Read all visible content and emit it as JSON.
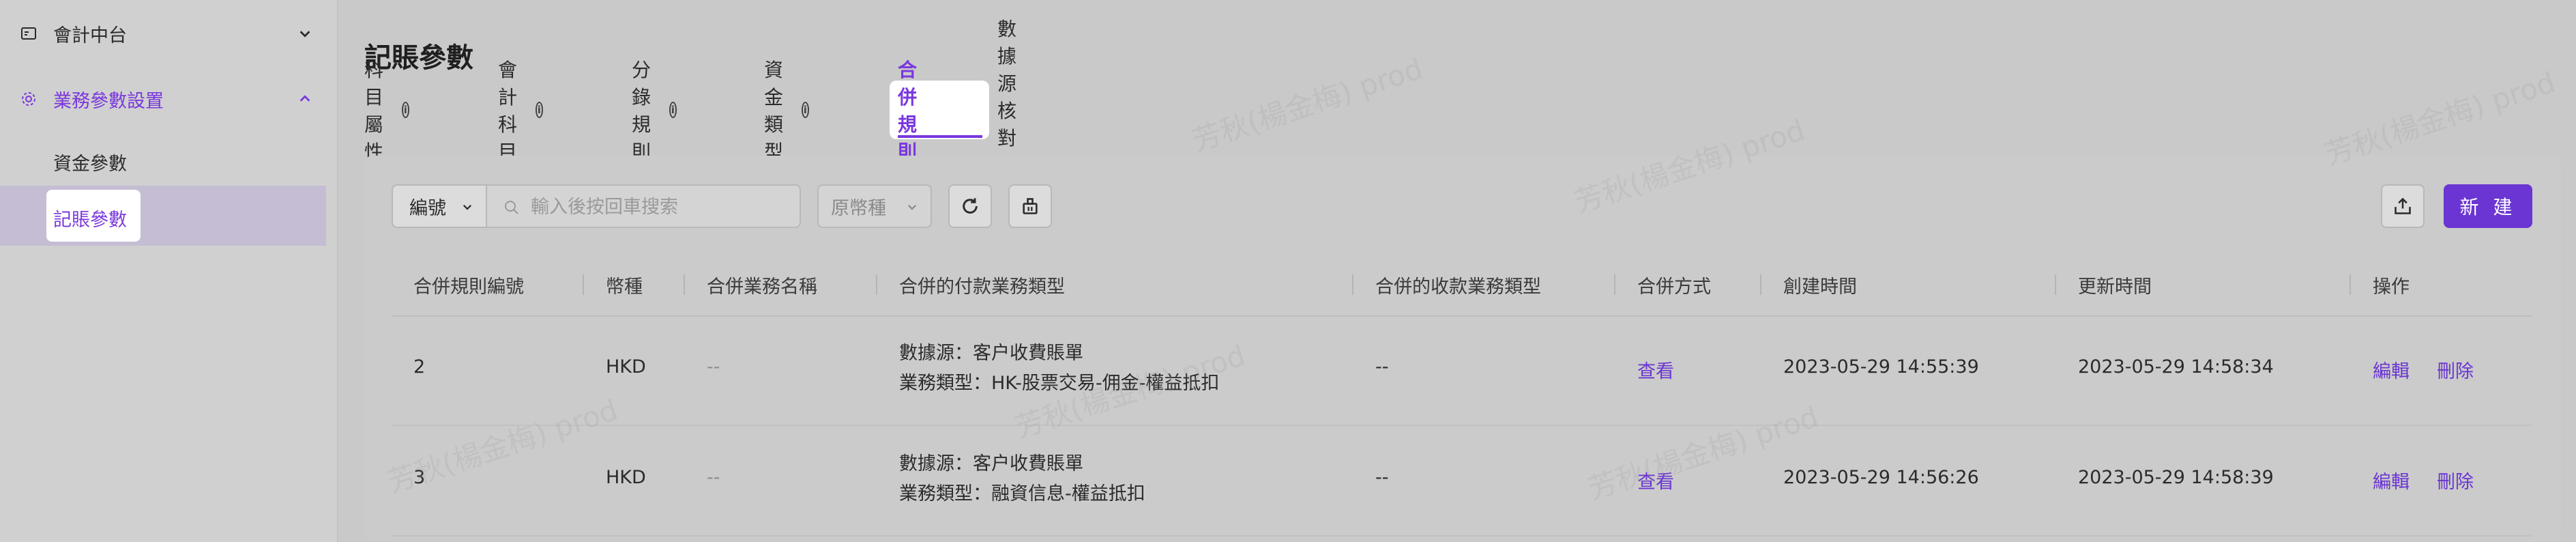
{
  "sidebar": {
    "group1": {
      "label": "會計中台",
      "icon": "ledger-icon"
    },
    "group2": {
      "label": "業務參數設置",
      "icon": "gear-icon"
    },
    "sub_items": [
      {
        "label": "資金參數"
      },
      {
        "label": "記賬參數"
      }
    ]
  },
  "page": {
    "title": "記賬參數"
  },
  "tabs": [
    {
      "label": "科目屬性"
    },
    {
      "label": "會計科目"
    },
    {
      "label": "分錄規則"
    },
    {
      "label": "資金類型"
    },
    {
      "label": "合併規則"
    },
    {
      "label": "數據源核對規則"
    }
  ],
  "toolbar": {
    "field_select": "編號",
    "search_placeholder": "輸入後按回車搜索",
    "currency_placeholder": "原幣種",
    "new_label": "新 建"
  },
  "table": {
    "headers": [
      "合併規則編號",
      "幣種",
      "合併業務名稱",
      "合併的付款業務類型",
      "合併的收款業務類型",
      "合併方式",
      "創建時間",
      "更新時間",
      "操作"
    ],
    "rows": [
      {
        "id": "2",
        "currency": "HKD",
        "name": "--",
        "pay_line1": "數據源：客户收費賬單",
        "pay_line2": "業務類型：HK-股票交易-佣金-權益抵扣",
        "recv": "--",
        "mode": "查看",
        "created": "2023-05-29 14:55:39",
        "updated": "2023-05-29 14:58:34",
        "edit": "編輯",
        "delete": "刪除"
      },
      {
        "id": "3",
        "currency": "HKD",
        "name": "--",
        "pay_line1": "數據源：客户收費賬單",
        "pay_line2": "業務類型：融資信息-權益抵扣",
        "recv": "--",
        "mode": "查看",
        "created": "2023-05-29 14:56:26",
        "updated": "2023-05-29 14:58:39",
        "edit": "編輯",
        "delete": "刪除"
      }
    ]
  },
  "watermark": "芳秋(楊金梅) prod",
  "colors": {
    "accent": "#6a35d2",
    "accent_text": "#7a37de"
  }
}
